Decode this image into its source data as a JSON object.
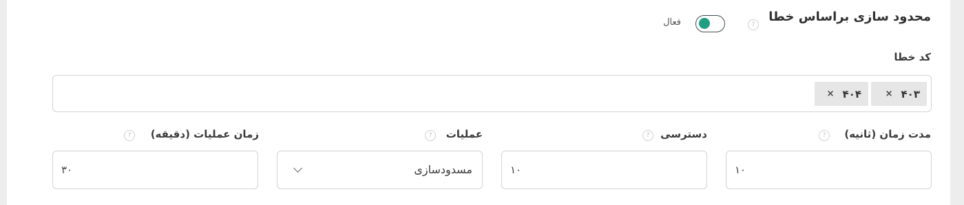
{
  "section": {
    "title": "محدود سازی براساس خطا",
    "toggle_label": "فعال",
    "toggle_on": true,
    "accent_color": "#1f9e82"
  },
  "error_code": {
    "label": "کد خطا",
    "tags": [
      "۴۰۳",
      "۴۰۴"
    ],
    "remove_symbol": "×"
  },
  "fields": {
    "duration": {
      "label": "مدت زمان (ثانیه)",
      "value": "۱۰"
    },
    "access": {
      "label": "دسترسی",
      "value": "۱۰"
    },
    "operation": {
      "label": "عملیات",
      "value": "مسدودسازی"
    },
    "operation_time": {
      "label": "زمان عملیات (دقیقه)",
      "value": "۳۰"
    }
  },
  "icons": {
    "help": "?"
  }
}
